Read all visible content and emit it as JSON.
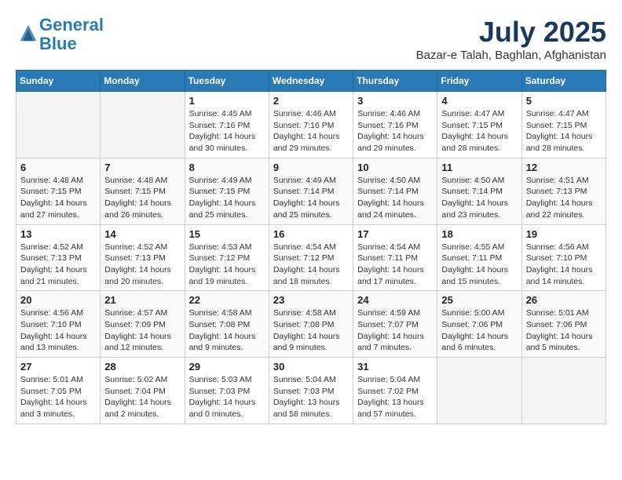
{
  "logo": {
    "line1": "General",
    "line2": "Blue"
  },
  "title": "July 2025",
  "location": "Bazar-e Talah, Baghlan, Afghanistan",
  "weekdays": [
    "Sunday",
    "Monday",
    "Tuesday",
    "Wednesday",
    "Thursday",
    "Friday",
    "Saturday"
  ],
  "weeks": [
    [
      {
        "day": "",
        "sunrise": "",
        "sunset": "",
        "daylight": ""
      },
      {
        "day": "",
        "sunrise": "",
        "sunset": "",
        "daylight": ""
      },
      {
        "day": "1",
        "sunrise": "Sunrise: 4:45 AM",
        "sunset": "Sunset: 7:16 PM",
        "daylight": "Daylight: 14 hours and 30 minutes."
      },
      {
        "day": "2",
        "sunrise": "Sunrise: 4:46 AM",
        "sunset": "Sunset: 7:16 PM",
        "daylight": "Daylight: 14 hours and 29 minutes."
      },
      {
        "day": "3",
        "sunrise": "Sunrise: 4:46 AM",
        "sunset": "Sunset: 7:16 PM",
        "daylight": "Daylight: 14 hours and 29 minutes."
      },
      {
        "day": "4",
        "sunrise": "Sunrise: 4:47 AM",
        "sunset": "Sunset: 7:15 PM",
        "daylight": "Daylight: 14 hours and 28 minutes."
      },
      {
        "day": "5",
        "sunrise": "Sunrise: 4:47 AM",
        "sunset": "Sunset: 7:15 PM",
        "daylight": "Daylight: 14 hours and 28 minutes."
      }
    ],
    [
      {
        "day": "6",
        "sunrise": "Sunrise: 4:48 AM",
        "sunset": "Sunset: 7:15 PM",
        "daylight": "Daylight: 14 hours and 27 minutes."
      },
      {
        "day": "7",
        "sunrise": "Sunrise: 4:48 AM",
        "sunset": "Sunset: 7:15 PM",
        "daylight": "Daylight: 14 hours and 26 minutes."
      },
      {
        "day": "8",
        "sunrise": "Sunrise: 4:49 AM",
        "sunset": "Sunset: 7:15 PM",
        "daylight": "Daylight: 14 hours and 25 minutes."
      },
      {
        "day": "9",
        "sunrise": "Sunrise: 4:49 AM",
        "sunset": "Sunset: 7:14 PM",
        "daylight": "Daylight: 14 hours and 25 minutes."
      },
      {
        "day": "10",
        "sunrise": "Sunrise: 4:50 AM",
        "sunset": "Sunset: 7:14 PM",
        "daylight": "Daylight: 14 hours and 24 minutes."
      },
      {
        "day": "11",
        "sunrise": "Sunrise: 4:50 AM",
        "sunset": "Sunset: 7:14 PM",
        "daylight": "Daylight: 14 hours and 23 minutes."
      },
      {
        "day": "12",
        "sunrise": "Sunrise: 4:51 AM",
        "sunset": "Sunset: 7:13 PM",
        "daylight": "Daylight: 14 hours and 22 minutes."
      }
    ],
    [
      {
        "day": "13",
        "sunrise": "Sunrise: 4:52 AM",
        "sunset": "Sunset: 7:13 PM",
        "daylight": "Daylight: 14 hours and 21 minutes."
      },
      {
        "day": "14",
        "sunrise": "Sunrise: 4:52 AM",
        "sunset": "Sunset: 7:13 PM",
        "daylight": "Daylight: 14 hours and 20 minutes."
      },
      {
        "day": "15",
        "sunrise": "Sunrise: 4:53 AM",
        "sunset": "Sunset: 7:12 PM",
        "daylight": "Daylight: 14 hours and 19 minutes."
      },
      {
        "day": "16",
        "sunrise": "Sunrise: 4:54 AM",
        "sunset": "Sunset: 7:12 PM",
        "daylight": "Daylight: 14 hours and 18 minutes."
      },
      {
        "day": "17",
        "sunrise": "Sunrise: 4:54 AM",
        "sunset": "Sunset: 7:11 PM",
        "daylight": "Daylight: 14 hours and 17 minutes."
      },
      {
        "day": "18",
        "sunrise": "Sunrise: 4:55 AM",
        "sunset": "Sunset: 7:11 PM",
        "daylight": "Daylight: 14 hours and 15 minutes."
      },
      {
        "day": "19",
        "sunrise": "Sunrise: 4:56 AM",
        "sunset": "Sunset: 7:10 PM",
        "daylight": "Daylight: 14 hours and 14 minutes."
      }
    ],
    [
      {
        "day": "20",
        "sunrise": "Sunrise: 4:56 AM",
        "sunset": "Sunset: 7:10 PM",
        "daylight": "Daylight: 14 hours and 13 minutes."
      },
      {
        "day": "21",
        "sunrise": "Sunrise: 4:57 AM",
        "sunset": "Sunset: 7:09 PM",
        "daylight": "Daylight: 14 hours and 12 minutes."
      },
      {
        "day": "22",
        "sunrise": "Sunrise: 4:58 AM",
        "sunset": "Sunset: 7:08 PM",
        "daylight": "Daylight: 14 hours and 9 minutes."
      },
      {
        "day": "23",
        "sunrise": "Sunrise: 4:58 AM",
        "sunset": "Sunset: 7:08 PM",
        "daylight": "Daylight: 14 hours and 9 minutes."
      },
      {
        "day": "24",
        "sunrise": "Sunrise: 4:59 AM",
        "sunset": "Sunset: 7:07 PM",
        "daylight": "Daylight: 14 hours and 7 minutes."
      },
      {
        "day": "25",
        "sunrise": "Sunrise: 5:00 AM",
        "sunset": "Sunset: 7:06 PM",
        "daylight": "Daylight: 14 hours and 6 minutes."
      },
      {
        "day": "26",
        "sunrise": "Sunrise: 5:01 AM",
        "sunset": "Sunset: 7:06 PM",
        "daylight": "Daylight: 14 hours and 5 minutes."
      }
    ],
    [
      {
        "day": "27",
        "sunrise": "Sunrise: 5:01 AM",
        "sunset": "Sunset: 7:05 PM",
        "daylight": "Daylight: 14 hours and 3 minutes."
      },
      {
        "day": "28",
        "sunrise": "Sunrise: 5:02 AM",
        "sunset": "Sunset: 7:04 PM",
        "daylight": "Daylight: 14 hours and 2 minutes."
      },
      {
        "day": "29",
        "sunrise": "Sunrise: 5:03 AM",
        "sunset": "Sunset: 7:03 PM",
        "daylight": "Daylight: 14 hours and 0 minutes."
      },
      {
        "day": "30",
        "sunrise": "Sunrise: 5:04 AM",
        "sunset": "Sunset: 7:03 PM",
        "daylight": "Daylight: 13 hours and 58 minutes."
      },
      {
        "day": "31",
        "sunrise": "Sunrise: 5:04 AM",
        "sunset": "Sunset: 7:02 PM",
        "daylight": "Daylight: 13 hours and 57 minutes."
      },
      {
        "day": "",
        "sunrise": "",
        "sunset": "",
        "daylight": ""
      },
      {
        "day": "",
        "sunrise": "",
        "sunset": "",
        "daylight": ""
      }
    ]
  ]
}
